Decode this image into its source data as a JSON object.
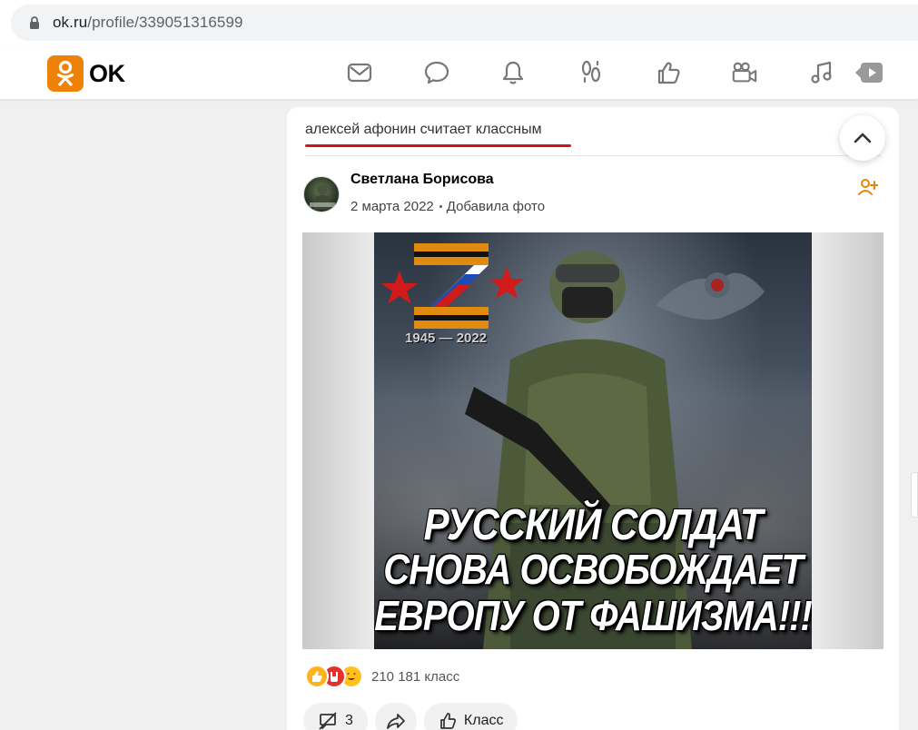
{
  "browser": {
    "url_host": "ok.ru",
    "url_path": "/profile/339051316599"
  },
  "topnav": {
    "logo_text": "OK",
    "icons": [
      "mail-icon",
      "chat-icon",
      "bell-icon",
      "footprints-icon",
      "like-icon",
      "video-icon",
      "music-icon",
      "play-icon"
    ]
  },
  "feed": {
    "header": "алексей афонин считает классным",
    "post": {
      "author": "Светлана Борисова",
      "date": "2 марта 2022",
      "action": "Добавила фото",
      "photo": {
        "years": "1945 — 2022",
        "caption_lines": [
          "РУССКИЙ СОЛДАТ",
          "СНОВА ОСВОБОЖДАЕТ",
          "ЕВРОПУ ОТ ФАШИЗМА!!!"
        ]
      },
      "reactions": {
        "count_text": "210 181 класс"
      },
      "buttons": {
        "comments_count": "3",
        "share_label": "",
        "like_label": "Класс"
      }
    }
  },
  "colors": {
    "brand_orange": "#ee8208",
    "accent_red": "#d3121e",
    "link_orange": "#ee8208"
  }
}
